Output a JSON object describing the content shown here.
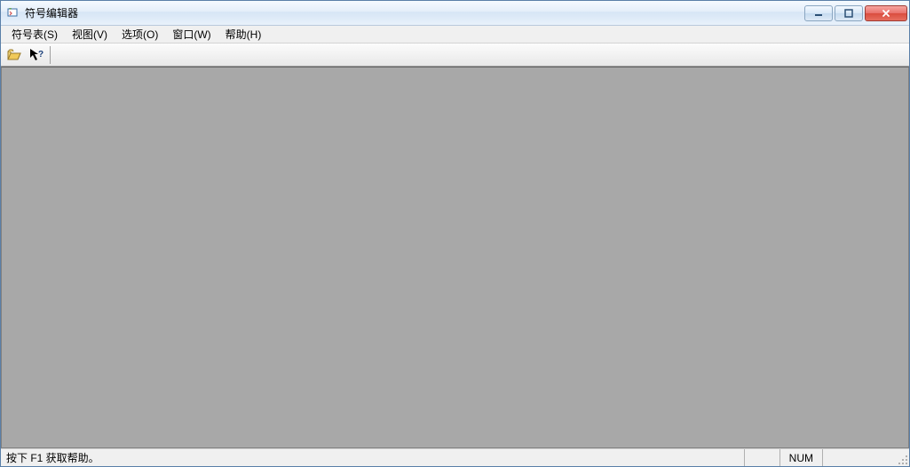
{
  "window": {
    "title": "符号编辑器"
  },
  "menu": {
    "items": [
      "符号表(S)",
      "视图(V)",
      "选项(O)",
      "窗口(W)",
      "帮助(H)"
    ]
  },
  "status": {
    "help_hint": "按下 F1 获取帮助。",
    "num_indicator": "NUM"
  },
  "icons": {
    "app": "app-icon",
    "open": "open-folder-icon",
    "context_help": "context-help-icon",
    "minimize": "minimize-icon",
    "maximize": "maximize-icon",
    "close": "close-icon"
  }
}
